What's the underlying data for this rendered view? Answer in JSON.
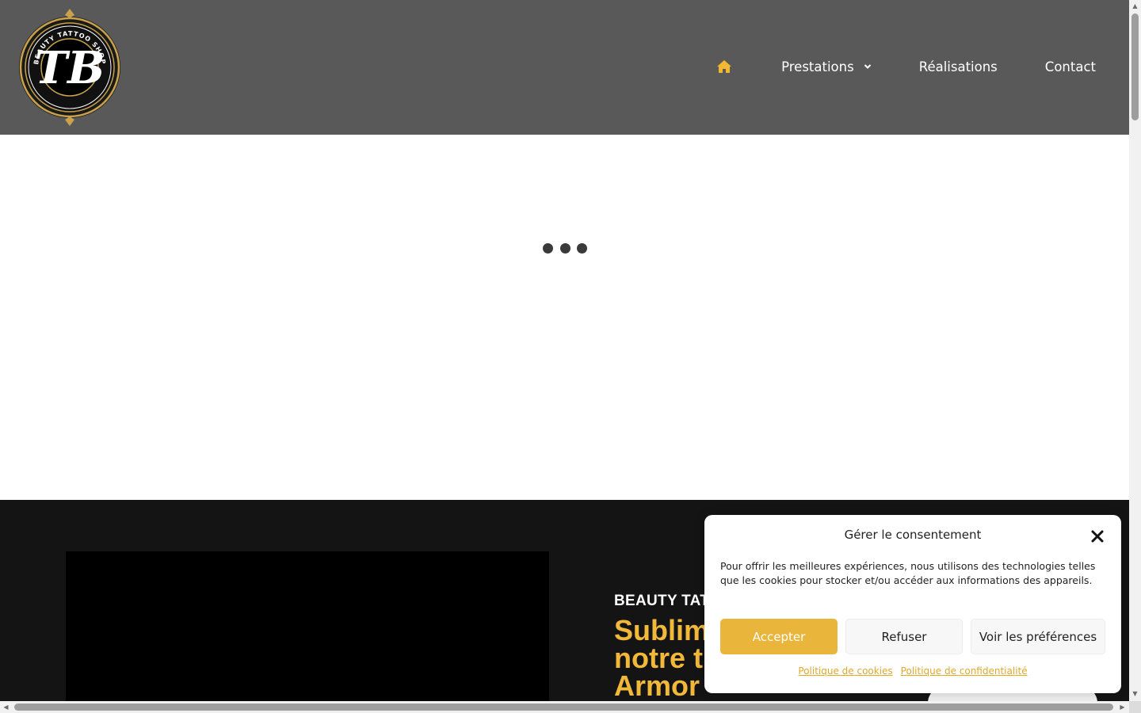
{
  "header": {
    "logo": {
      "ring_text": "BEAUTY TATTOO SHOP",
      "monogram": "TB"
    },
    "nav": {
      "home_icon": "home-icon",
      "items": [
        {
          "label": "Prestations",
          "has_dropdown": true
        },
        {
          "label": "Réalisations"
        },
        {
          "label": "Contact"
        }
      ]
    }
  },
  "hero": {
    "kicker": "BEAUTY TAT",
    "headline": "Sublim\nnotre t\nArmor"
  },
  "consent": {
    "title": "Gérer le consentement",
    "text": "Pour offrir les meilleures expériences, nous utilisons des technologies telles que les cookies pour stocker et/ou accéder aux informations des appareils.",
    "accept": "Accepter",
    "refuse": "Refuser",
    "preferences": "Voir les préférences",
    "cookie_policy": "Politique de cookies",
    "privacy_policy": "Politique de confidentialité"
  },
  "colors": {
    "header_bg": "#595959",
    "accent": "#e9b63b",
    "dark_section_bg": "#141414",
    "headline": "#f2b83a"
  }
}
